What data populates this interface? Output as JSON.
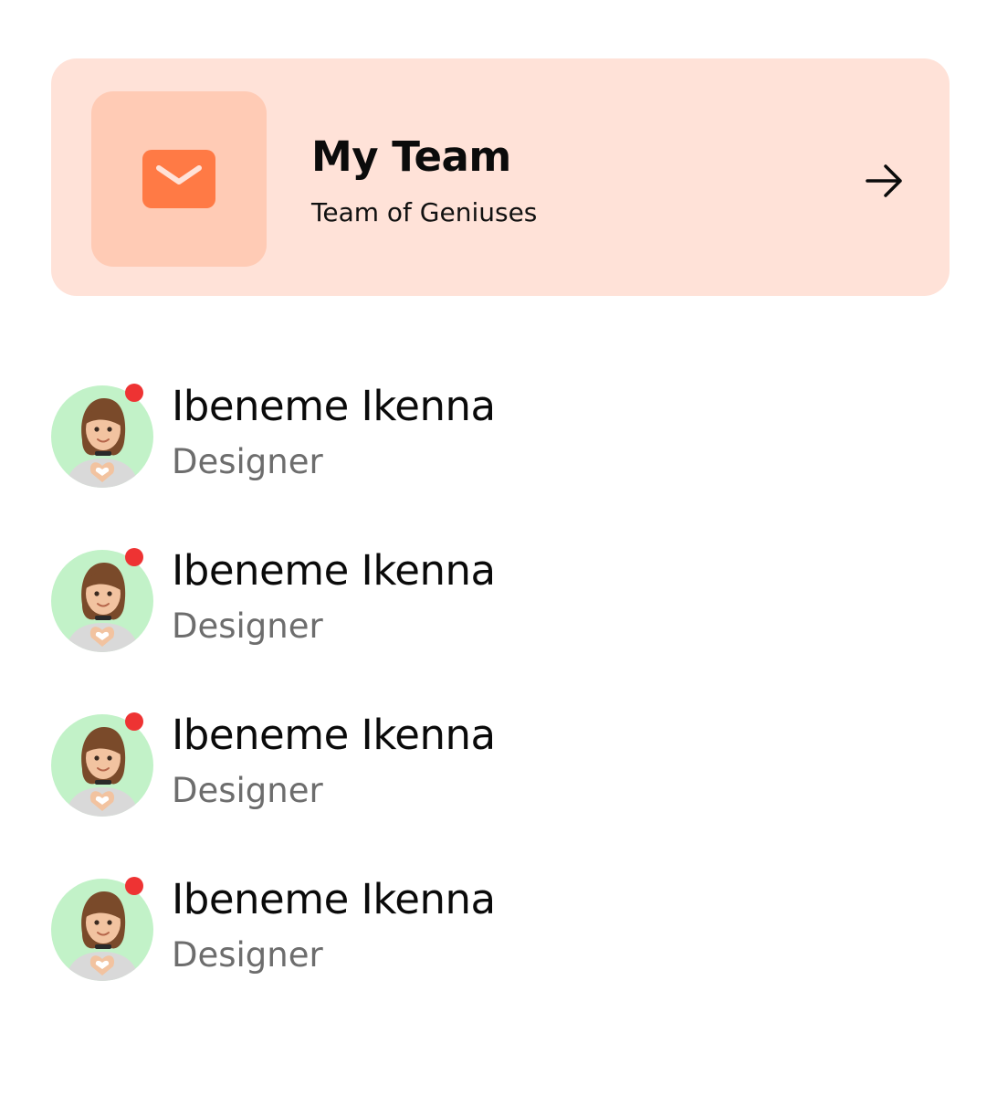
{
  "team": {
    "title": "My Team",
    "subtitle": "Team of Geniuses",
    "icon": "mail-icon",
    "action_icon": "arrow-right-icon"
  },
  "members": [
    {
      "name": "Ibeneme Ikenna",
      "role": "Designer",
      "online": true
    },
    {
      "name": "Ibeneme Ikenna",
      "role": "Designer",
      "online": true
    },
    {
      "name": "Ibeneme Ikenna",
      "role": "Designer",
      "online": true
    },
    {
      "name": "Ibeneme Ikenna",
      "role": "Designer",
      "online": true
    }
  ],
  "colors": {
    "card_background": "#ffe2d8",
    "icon_box_background": "#ffcbb5",
    "accent": "#ff7a45",
    "avatar_background": "#c2f2c8",
    "status_dot": "#ee3333",
    "role_text": "#6d6d6d"
  }
}
